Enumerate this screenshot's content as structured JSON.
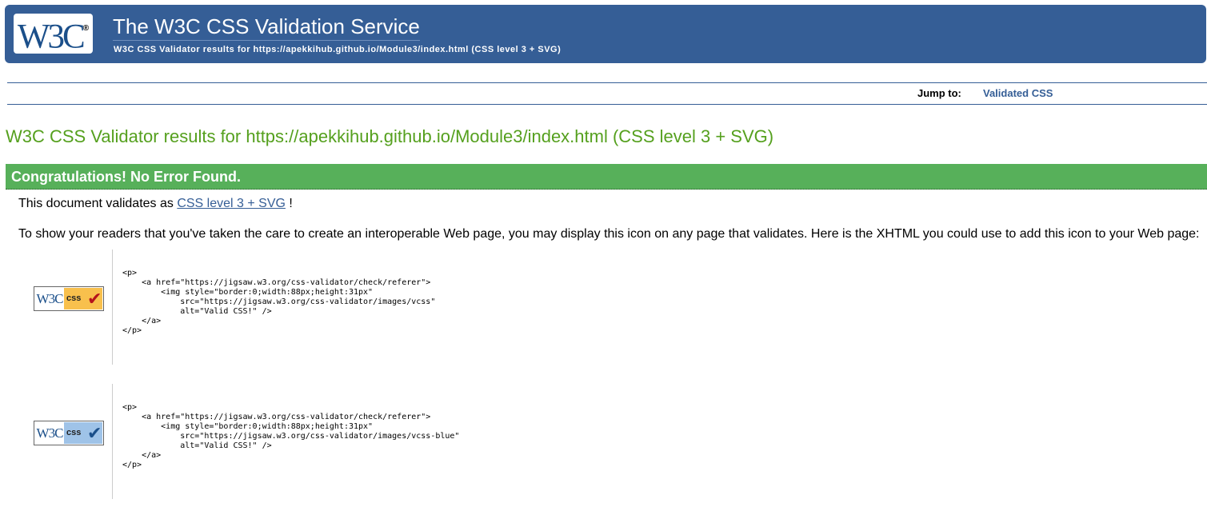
{
  "header": {
    "logo_text": "W3C",
    "logo_mark": "®",
    "title": "The W3C CSS Validation Service",
    "subtitle": "W3C CSS Validator results for https://apekkihub.github.io/Module3/index.html (CSS level 3 + SVG)"
  },
  "jump": {
    "label": "Jump to:",
    "link": "Validated CSS"
  },
  "results": {
    "heading": "W3C CSS Validator results for https://apekkihub.github.io/Module3/index.html (CSS level 3 + SVG)",
    "success": "Congratulations! No Error Found.",
    "validates_prefix": "This document validates as ",
    "validates_link": "CSS level 3 + SVG",
    "validates_suffix": " !",
    "display_text": "To show your readers that you've taken the care to create an interoperable Web page, you may display this icon on any page that validates. Here is the XHTML you could use to add this icon to your Web page:"
  },
  "badges": [
    {
      "w3": "W3C",
      "css": "css",
      "code": "<p>\n    <a href=\"https://jigsaw.w3.org/css-validator/check/referer\">\n        <img style=\"border:0;width:88px;height:31px\"\n            src=\"https://jigsaw.w3.org/css-validator/images/vcss\"\n            alt=\"Valid CSS!\" />\n    </a>\n</p>"
    },
    {
      "w3": "W3C",
      "css": "css",
      "code": "<p>\n    <a href=\"https://jigsaw.w3.org/css-validator/check/referer\">\n        <img style=\"border:0;width:88px;height:31px\"\n            src=\"https://jigsaw.w3.org/css-validator/images/vcss-blue\"\n            alt=\"Valid CSS!\" />\n    </a>\n</p>"
    }
  ],
  "colors": {
    "banner": "#355e96",
    "heading": "#55a01e",
    "success_bar": "#57b05a",
    "link": "#355e96"
  }
}
